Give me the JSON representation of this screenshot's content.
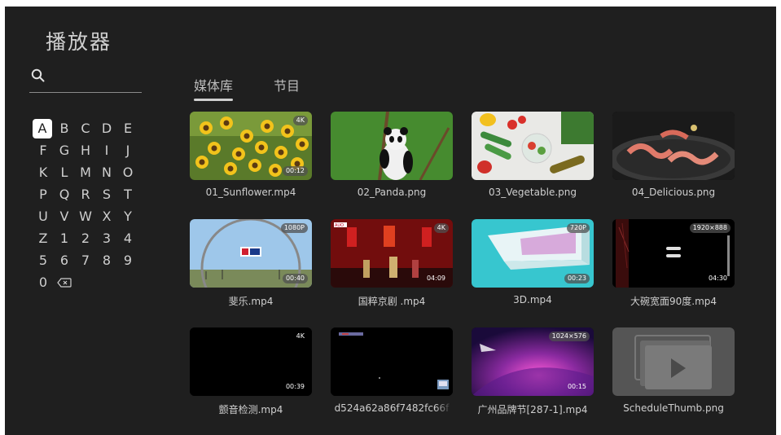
{
  "app": {
    "title": "播放器"
  },
  "search": {
    "icon": "search-icon",
    "value": ""
  },
  "keyboard": {
    "active_key": "A",
    "rows": [
      [
        "A",
        "B",
        "C",
        "D",
        "E"
      ],
      [
        "F",
        "G",
        "H",
        "I",
        "J"
      ],
      [
        "K",
        "L",
        "M",
        "N",
        "O"
      ],
      [
        "P",
        "Q",
        "R",
        "S",
        "T"
      ],
      [
        "U",
        "V",
        "W",
        "X",
        "Y"
      ],
      [
        "Z",
        "1",
        "2",
        "3",
        "4"
      ],
      [
        "5",
        "6",
        "7",
        "8",
        "9"
      ]
    ],
    "last_row": [
      "0"
    ],
    "backspace_icon": "backspace-icon"
  },
  "tabs": [
    {
      "label": "媒体库",
      "active": true
    },
    {
      "label": "节目",
      "active": false
    }
  ],
  "media": [
    {
      "name": "01_Sunflower.mp4",
      "resolution": "4K",
      "duration": "00:12",
      "thumb": "sunflower"
    },
    {
      "name": "02_Panda.png",
      "resolution": "",
      "duration": "",
      "thumb": "panda"
    },
    {
      "name": "03_Vegetable.png",
      "resolution": "",
      "duration": "",
      "thumb": "vegetable"
    },
    {
      "name": "04_Delicious.png",
      "resolution": "",
      "duration": "",
      "thumb": "delicious"
    },
    {
      "name": "斐乐.mp4",
      "resolution": "1080P",
      "duration": "00:40",
      "thumb": "fila"
    },
    {
      "name": "国粹京剧 .mp4",
      "resolution": "4K",
      "duration": "04:09",
      "thumb": "opera"
    },
    {
      "name": "3D.mp4",
      "resolution": "720P",
      "duration": "00:23",
      "thumb": "3d"
    },
    {
      "name": "大碗宽面90度.mp4",
      "resolution": "1920×888",
      "duration": "04:30",
      "thumb": "noodle"
    },
    {
      "name": "颤音检测.mp4",
      "resolution": "4K",
      "duration": "00:39",
      "thumb": "black"
    },
    {
      "name": "d524a62a86f7482fc66f",
      "resolution": "",
      "duration": "",
      "thumb": "dark"
    },
    {
      "name": "广州品牌节[287-1].mp4",
      "resolution": "1024×576",
      "duration": "00:15",
      "thumb": "brand"
    },
    {
      "name": "ScheduleThumb.png",
      "resolution": "",
      "duration": "",
      "thumb": "schedule"
    }
  ],
  "colors": {
    "background": "#1f1f1f",
    "text": "#cfcfcf",
    "active_key_bg": "#ffffff"
  }
}
